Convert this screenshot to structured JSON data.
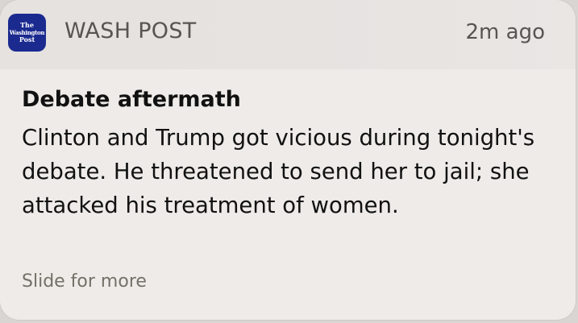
{
  "notification": {
    "app_icon": {
      "name": "washington-post-logo",
      "color": "#1b2a8f",
      "lines": [
        "The",
        "Washington",
        "Post"
      ]
    },
    "app_name": "WASH POST",
    "timestamp": "2m ago",
    "title": "Debate aftermath",
    "message": "Clinton and Trump got vicious during tonight's debate. He threatened to send her to jail; she attacked his treatment of women.",
    "action_hint": "Slide for more"
  }
}
